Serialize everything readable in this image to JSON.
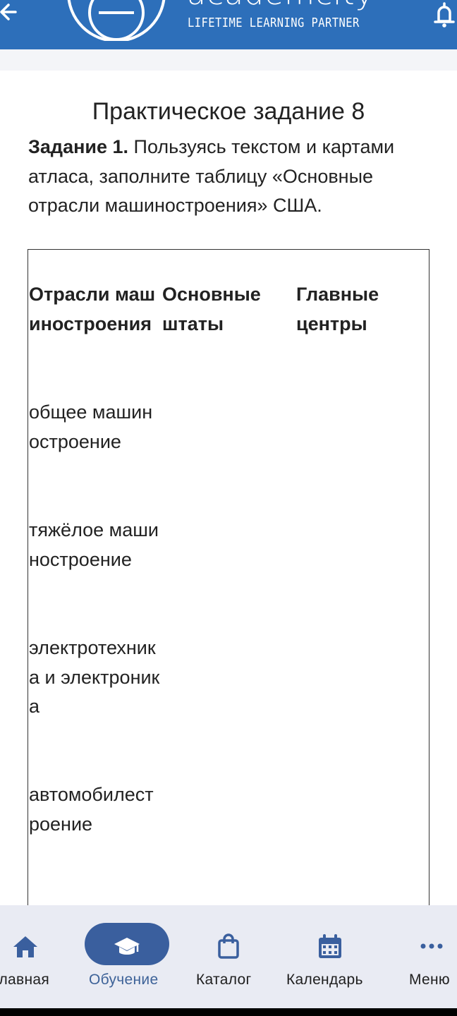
{
  "header": {
    "brand": "academcity",
    "tagline": "LIFETIME LEARNING PARTNER"
  },
  "page": {
    "title": "Практическое задание 8",
    "task_label": "Задание 1.",
    "task_text": " Пользуясь текстом и картами атласа, заполните таблицу «Основные отрасли машиностроения» США."
  },
  "table": {
    "headers": [
      "Отрасли машиностроения",
      "Основные штаты",
      "Главные центры"
    ],
    "rows": [
      [
        "общее машиностроение",
        "",
        ""
      ],
      [
        "тяжёлое машиностроение",
        "",
        ""
      ],
      [
        "электротехника и электроника",
        "",
        ""
      ],
      [
        "автомобилестроение",
        "",
        ""
      ]
    ]
  },
  "nav": {
    "items": [
      {
        "label": "Главная",
        "icon": "home-icon"
      },
      {
        "label": "Обучение",
        "icon": "graduation-cap-icon",
        "active": true
      },
      {
        "label": "Каталог",
        "icon": "shopping-bag-icon"
      },
      {
        "label": "Календарь",
        "icon": "calendar-icon"
      },
      {
        "label": "Меню",
        "icon": "more-dots-icon"
      }
    ]
  },
  "colors": {
    "header_bg": "#2d6fba",
    "nav_bg": "#e9ebf3",
    "active_pill": "#3a5f9e",
    "active_text": "#3d6298"
  }
}
